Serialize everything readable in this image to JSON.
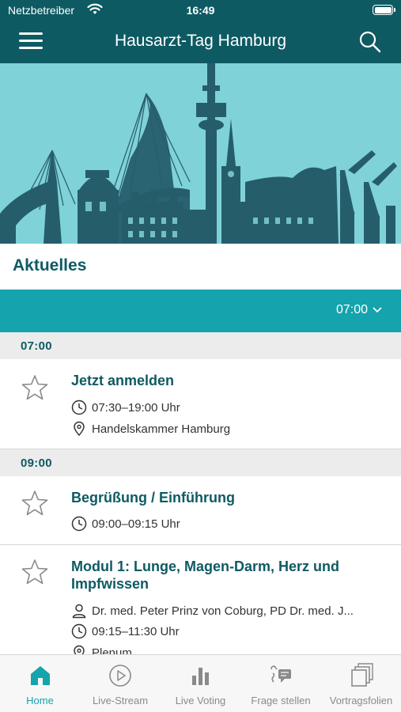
{
  "status_bar": {
    "carrier": "Netzbetreiber",
    "time": "16:49"
  },
  "nav": {
    "title": "Hausarzt-Tag Hamburg",
    "menu_icon": "menu-icon",
    "search_icon": "search-icon"
  },
  "section": {
    "title": "Aktuelles"
  },
  "filter": {
    "selected": "07:00"
  },
  "groups": [
    {
      "time": "07:00",
      "items": [
        {
          "title": "Jetzt anmelden",
          "time": "07:30–19:00 Uhr",
          "location": "Handelskammer Hamburg"
        }
      ]
    },
    {
      "time": "09:00",
      "items": [
        {
          "title": "Begrüßung / Einführung",
          "time": "09:00–09:15 Uhr"
        },
        {
          "title_line1": "Modul 1: Lunge, Magen-Darm, Herz und",
          "title_line2": "Impfwissen",
          "speakers": "Dr. med. Peter Prinz von Coburg, PD Dr. med. J...",
          "time": "09:15–11:30 Uhr",
          "location": "Plenum"
        }
      ]
    }
  ],
  "tabs": [
    {
      "label": "Home",
      "icon": "home-icon",
      "active": true
    },
    {
      "label": "Live-Stream",
      "icon": "play-icon",
      "active": false
    },
    {
      "label": "Live Voting",
      "icon": "bar-chart-icon",
      "active": false
    },
    {
      "label": "Frage stellen",
      "icon": "chat-question-icon",
      "active": false
    },
    {
      "label": "Vortragsfolien",
      "icon": "slides-icon",
      "active": false
    }
  ],
  "colors": {
    "primary_dark": "#0e5a63",
    "accent": "#15a3ad",
    "hero_bg": "#7fd2d8",
    "skyline": "#265d6b"
  }
}
